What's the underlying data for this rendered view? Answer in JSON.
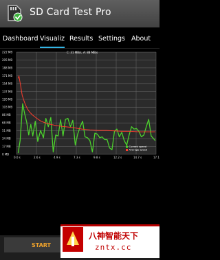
{
  "app": {
    "title": "SD Card Test Pro",
    "icon": "sd-card-green-check-icon"
  },
  "tabs": [
    {
      "label": "Dashboard",
      "selected": false
    },
    {
      "label": "Visualiz",
      "selected": true
    },
    {
      "label": "Results",
      "selected": false
    },
    {
      "label": "Settings",
      "selected": false
    },
    {
      "label": "About",
      "selected": false
    }
  ],
  "chart_data": {
    "type": "line",
    "annotation": "C: 31 MB/s, A: 88 MB/s",
    "y_ticks": [
      "222 MB",
      "205 MB",
      "188 MB",
      "171 MB",
      "154 MB",
      "137 MB",
      "120 MB",
      "103 MB",
      "86 MB",
      "68 MB",
      "51 MB",
      "34 MB",
      "17 MB",
      "0 MB"
    ],
    "x_ticks": [
      "0.0 s",
      "2.6 s",
      "4.9 s",
      "7.3 s",
      "9.8 s",
      "12.2 s",
      "14.7 s",
      "17.1 s"
    ],
    "ylim": [
      0,
      222
    ],
    "xlim": [
      0,
      17.1
    ],
    "grid": true,
    "legend_position": "bottom-right",
    "series": [
      {
        "name": "Current speed",
        "color": "#4cd12d",
        "x": [
          0.2,
          0.45,
          0.75,
          1.0,
          1.25,
          1.5,
          1.75,
          2.0,
          2.3,
          2.6,
          2.95,
          3.3,
          3.6,
          3.9,
          4.2,
          4.5,
          4.8,
          5.1,
          5.4,
          5.7,
          6.0,
          6.3,
          6.6,
          6.9,
          7.2,
          7.5,
          7.8,
          8.1,
          8.4,
          8.7,
          9.0,
          9.3,
          9.6,
          9.9,
          10.2,
          10.5,
          10.8,
          11.1,
          11.4,
          11.7,
          12.0,
          12.3,
          12.6,
          12.9,
          13.2,
          13.5,
          13.8,
          14.1,
          14.4,
          14.7,
          15.0,
          15.3,
          15.6,
          15.9,
          16.2,
          16.5,
          16.8,
          17.0
        ],
        "y": [
          3,
          30,
          110,
          88,
          70,
          42,
          65,
          40,
          72,
          28,
          52,
          36,
          78,
          60,
          80,
          5,
          42,
          40,
          75,
          40,
          76,
          78,
          60,
          74,
          20,
          44,
          60,
          72,
          38,
          36,
          30,
          5,
          46,
          44,
          36,
          38,
          32,
          32,
          14,
          10,
          50,
          55,
          38,
          48,
          30,
          20,
          42,
          60,
          55,
          56,
          50,
          38,
          42,
          60,
          76,
          40,
          34,
          30
        ]
      },
      {
        "name": "Average speed",
        "color": "#ff3d2e",
        "x": [
          0.2,
          0.3,
          0.5,
          0.7,
          1.0,
          1.3,
          1.6,
          2.0,
          2.5,
          3.0,
          3.6,
          4.2,
          5.0,
          6.0,
          7.0,
          8.0,
          9.0,
          10.0,
          11.0,
          12.0,
          13.0,
          14.0,
          15.0,
          16.0,
          17.0
        ],
        "y": [
          165,
          170,
          150,
          128,
          112,
          100,
          92,
          85,
          78,
          72,
          68,
          65,
          62,
          60,
          58,
          55,
          53,
          52,
          52,
          51,
          50,
          50,
          49,
          49,
          49
        ]
      }
    ]
  },
  "buttons": {
    "start_label": "START"
  },
  "watermark": {
    "chinese_text": "八神智能天下",
    "url": "zntx.cc"
  }
}
